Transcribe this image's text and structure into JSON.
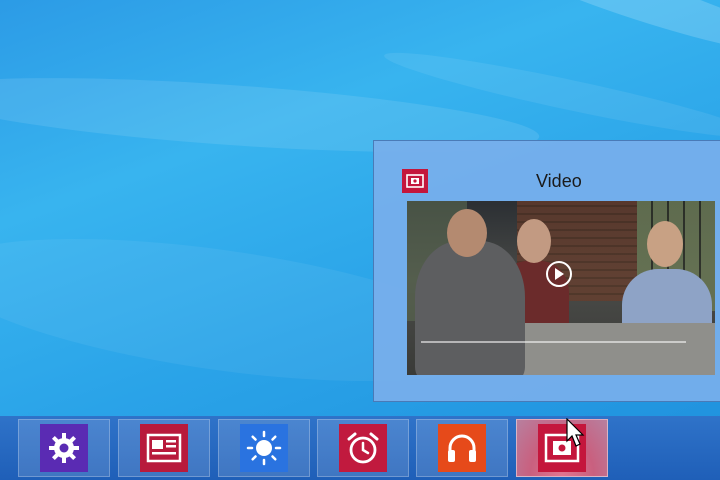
{
  "preview": {
    "title": "Video",
    "icon": "video-app-icon"
  },
  "taskbar": {
    "items": [
      {
        "name": "settings-app-icon",
        "color": "#5a2bb3",
        "active": false
      },
      {
        "name": "news-app-icon",
        "color": "#b81a3c",
        "active": false
      },
      {
        "name": "weather-app-icon",
        "color": "#2a73e0",
        "active": false
      },
      {
        "name": "alarms-app-icon",
        "color": "#c11a3e",
        "active": false
      },
      {
        "name": "music-app-icon",
        "color": "#e64a1a",
        "active": false
      },
      {
        "name": "video-app-icon",
        "color": "#c4163c",
        "active": true
      }
    ]
  },
  "colors": {
    "desktop": "#2aa3e8",
    "taskbar": "#2366be",
    "preview_bg": "#78afeb"
  }
}
